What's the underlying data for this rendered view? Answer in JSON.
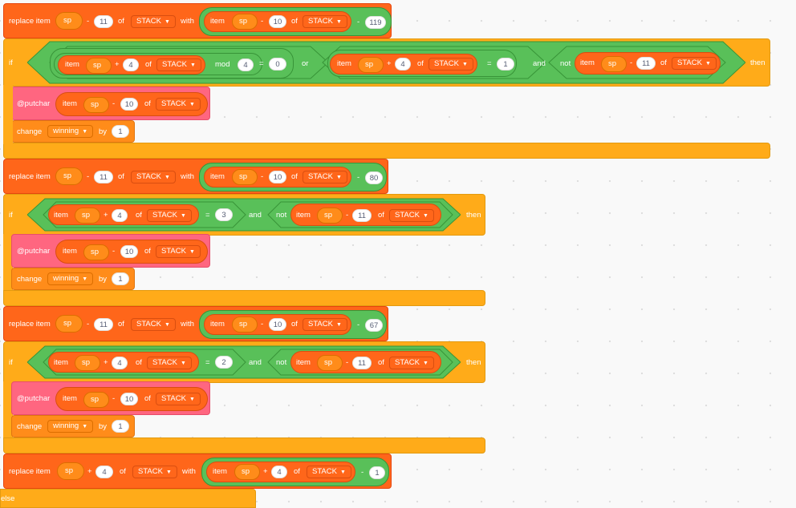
{
  "colors": {
    "data": "#ff661a",
    "control": "#ffab19",
    "custom": "#ff6680",
    "operator": "#59c059",
    "variable": "#ff8c1a",
    "workspace": "#f9f9f9"
  },
  "labels": {
    "replace_item": "replace item",
    "with": "with",
    "item": "item",
    "of": "of",
    "if": "if",
    "then": "then",
    "mod": "mod",
    "or": "or",
    "and": "and",
    "not": "not",
    "putchar": "@putchar",
    "change": "change",
    "by": "by",
    "else": "else",
    "sp": "sp",
    "stack": "STACK",
    "winning": "winning",
    "minus": "-",
    "plus": "+",
    "eq": "="
  },
  "values": {
    "eleven": "11",
    "ten": "10",
    "four": "4",
    "zero": "0",
    "one": "1",
    "three": "3",
    "two": "2",
    "c119": "119",
    "c80": "80",
    "c67": "67"
  }
}
